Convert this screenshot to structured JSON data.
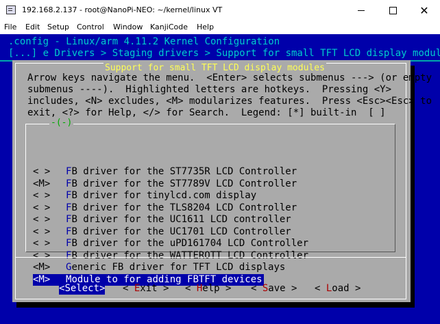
{
  "window": {
    "title": "192.168.2.137 - root@NanoPi-NEO: ~/kernel/linux VT",
    "close_glyph": "✕"
  },
  "menubar": {
    "items": [
      "File",
      "Edit",
      "Setup",
      "Control",
      "Window",
      "KanjiCode",
      "Help"
    ]
  },
  "terminal": {
    "header_line": ".config - Linux/arm 4.11.2 Kernel Configuration",
    "breadcrumb": "[...] e Drivers > Staging drivers > Support for small TFT LCD display modules"
  },
  "dialog": {
    "title": "Support for small TFT LCD display modules",
    "help_lines": [
      "Arrow keys navigate the menu.  <Enter> selects submenus ---> (or empty",
      "submenus ----).  Highlighted letters are hotkeys.  Pressing <Y>",
      "includes, <N> excludes, <M> modularizes features.  Press <Esc><Esc> to",
      "exit, <?> for Help, </> for Search.  Legend: [*] built-in  [ ]"
    ],
    "scroll_indicator": "-(-)",
    "items": [
      {
        "box": "< >",
        "hotkey": "F",
        "rest": "B driver for the ST7735R LCD Controller"
      },
      {
        "box": "<M>",
        "hotkey": "F",
        "rest": "B driver for the ST7789V LCD Controller"
      },
      {
        "box": "< >",
        "hotkey": "F",
        "rest": "B driver for tinylcd.com display"
      },
      {
        "box": "< >",
        "hotkey": "F",
        "rest": "B driver for the TLS8204 LCD Controller"
      },
      {
        "box": "< >",
        "hotkey": "F",
        "rest": "B driver for the UC1611 LCD controller"
      },
      {
        "box": "< >",
        "hotkey": "F",
        "rest": "B driver for the UC1701 LCD Controller"
      },
      {
        "box": "< >",
        "hotkey": "F",
        "rest": "B driver for the uPD161704 LCD Controller"
      },
      {
        "box": "< >",
        "hotkey": "F",
        "rest": "B driver for the WATTEROTT LCD Controller"
      },
      {
        "box": "<M>",
        "hotkey": "G",
        "rest": "eneric FB driver for TFT LCD displays"
      },
      {
        "box": "<M>",
        "hotkey": "M",
        "rest": "odule to for adding FBTFT devices"
      }
    ],
    "selected_index": 9,
    "buttons": [
      {
        "open": "<",
        "hotkey": "S",
        "rest": "elect",
        "close": ">",
        "selected": true
      },
      {
        "open": "< ",
        "hotkey": "E",
        "rest": "xit",
        "close": " >",
        "selected": false
      },
      {
        "open": "< ",
        "hotkey": "H",
        "rest": "elp",
        "close": " >",
        "selected": false
      },
      {
        "open": "< ",
        "hotkey": "S",
        "rest": "ave",
        "close": " >",
        "selected": false
      },
      {
        "open": "< ",
        "hotkey": "L",
        "rest": "oad",
        "close": " >",
        "selected": false
      }
    ]
  },
  "colors": {
    "terminal_bg": "#0000aa",
    "dialog_bg": "#aaaaaa",
    "title_yellow": "#ffff55",
    "hotkey_red": "#aa0000",
    "hotkey_blue": "#0000aa",
    "breadcrumb_cyan": "#00cccc"
  }
}
